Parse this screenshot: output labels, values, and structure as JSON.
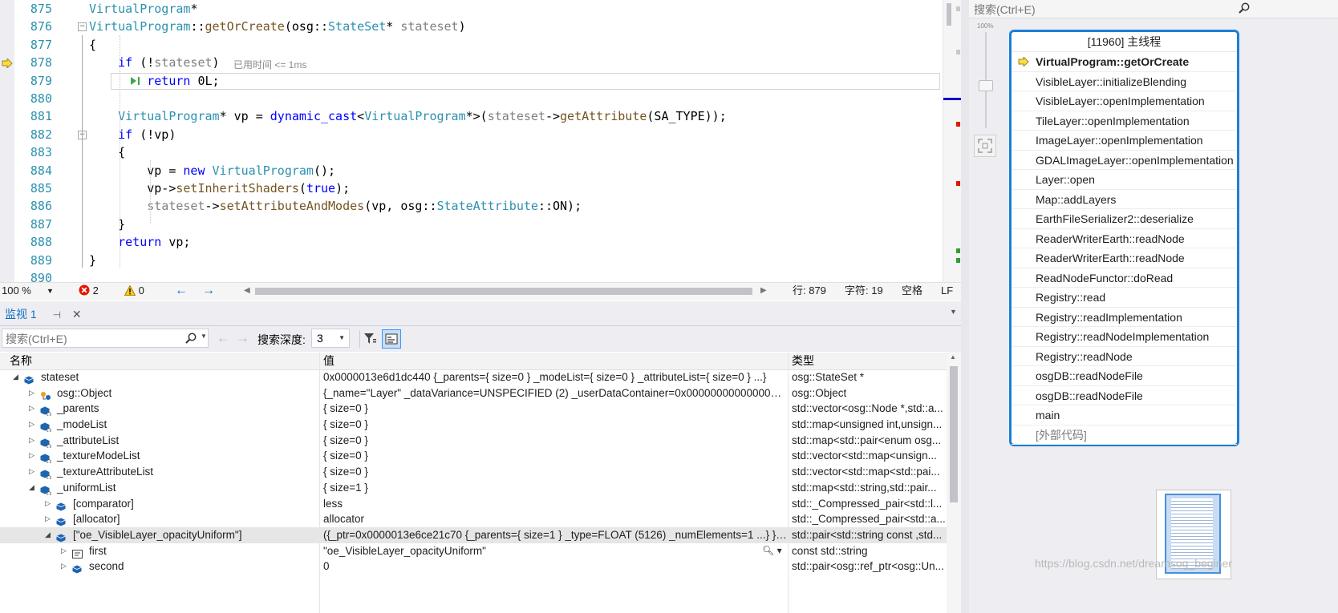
{
  "editor": {
    "lines": [
      {
        "num": "875",
        "code": [
          {
            "c": "t",
            "v": "VirtualProgram"
          },
          {
            "c": "n",
            "v": "*"
          }
        ]
      },
      {
        "num": "876",
        "code": [
          {
            "c": "t",
            "v": "VirtualProgram"
          },
          {
            "c": "n",
            "v": "::"
          },
          {
            "c": "f",
            "v": "getOrCreate"
          },
          {
            "c": "n",
            "v": "("
          },
          {
            "c": "n",
            "v": "osg"
          },
          {
            "c": "n",
            "v": "::"
          },
          {
            "c": "t",
            "v": "StateSet"
          },
          {
            "c": "n",
            "v": "* "
          },
          {
            "c": "p",
            "v": "stateset"
          },
          {
            "c": "n",
            "v": ")"
          }
        ]
      },
      {
        "num": "877",
        "code": [
          {
            "c": "n",
            "v": "{"
          }
        ]
      },
      {
        "num": "878",
        "code": [
          {
            "c": "n",
            "v": "    "
          },
          {
            "c": "k",
            "v": "if"
          },
          {
            "c": "n",
            "v": " (!"
          },
          {
            "c": "p",
            "v": "stateset"
          },
          {
            "c": "n",
            "v": ")"
          }
        ]
      },
      {
        "num": "879",
        "code": [
          {
            "c": "n",
            "v": "        "
          },
          {
            "c": "k",
            "v": "return"
          },
          {
            "c": "n",
            "v": " 0L;"
          }
        ]
      },
      {
        "num": "880",
        "code": []
      },
      {
        "num": "881",
        "code": [
          {
            "c": "n",
            "v": "    "
          },
          {
            "c": "t",
            "v": "VirtualProgram"
          },
          {
            "c": "n",
            "v": "* vp = "
          },
          {
            "c": "k",
            "v": "dynamic_cast"
          },
          {
            "c": "n",
            "v": "<"
          },
          {
            "c": "t",
            "v": "VirtualProgram"
          },
          {
            "c": "n",
            "v": "*>("
          },
          {
            "c": "p",
            "v": "stateset"
          },
          {
            "c": "n",
            "v": "->"
          },
          {
            "c": "f",
            "v": "getAttribute"
          },
          {
            "c": "n",
            "v": "(SA_TYPE));"
          }
        ]
      },
      {
        "num": "882",
        "code": [
          {
            "c": "n",
            "v": "    "
          },
          {
            "c": "k",
            "v": "if"
          },
          {
            "c": "n",
            "v": " (!vp)"
          }
        ]
      },
      {
        "num": "883",
        "code": [
          {
            "c": "n",
            "v": "    {"
          }
        ]
      },
      {
        "num": "884",
        "code": [
          {
            "c": "n",
            "v": "        vp = "
          },
          {
            "c": "k",
            "v": "new"
          },
          {
            "c": "n",
            "v": " "
          },
          {
            "c": "t",
            "v": "VirtualProgram"
          },
          {
            "c": "n",
            "v": "();"
          }
        ]
      },
      {
        "num": "885",
        "code": [
          {
            "c": "n",
            "v": "        vp->"
          },
          {
            "c": "f",
            "v": "setInheritShaders"
          },
          {
            "c": "n",
            "v": "("
          },
          {
            "c": "k",
            "v": "true"
          },
          {
            "c": "n",
            "v": ");"
          }
        ]
      },
      {
        "num": "886",
        "code": [
          {
            "c": "n",
            "v": "        "
          },
          {
            "c": "p",
            "v": "stateset"
          },
          {
            "c": "n",
            "v": "->"
          },
          {
            "c": "f",
            "v": "setAttributeAndModes"
          },
          {
            "c": "n",
            "v": "(vp, osg::"
          },
          {
            "c": "t",
            "v": "StateAttribute"
          },
          {
            "c": "n",
            "v": "::ON);"
          }
        ]
      },
      {
        "num": "887",
        "code": [
          {
            "c": "n",
            "v": "    }"
          }
        ]
      },
      {
        "num": "888",
        "code": [
          {
            "c": "n",
            "v": "    "
          },
          {
            "c": "k",
            "v": "return"
          },
          {
            "c": "n",
            "v": " vp;"
          }
        ]
      },
      {
        "num": "889",
        "code": [
          {
            "c": "n",
            "v": "}"
          }
        ]
      },
      {
        "num": "890",
        "code": []
      }
    ],
    "elapsed_hint": "已用时间 <= 1ms",
    "status": {
      "zoom": "100 %",
      "errors": "2",
      "warnings": "0",
      "line": "行: 879",
      "char": "字符: 19",
      "whitespace": "空格",
      "eol": "LF"
    }
  },
  "watch": {
    "tab_label": "监视 1",
    "search_placeholder": "搜索(Ctrl+E)",
    "depth_label": "搜索深度:",
    "depth_value": "3",
    "columns": {
      "name": "名称",
      "value": "值",
      "type": "类型"
    },
    "rows": [
      {
        "indent": 0,
        "exp": "◢",
        "icon": "object",
        "name": "stateset",
        "value": "0x0000013e6d1dc440 {_parents={ size=0 } _modeList={ size=0 } _attributeList={ size=0 } ...}",
        "type": "osg::StateSet *"
      },
      {
        "indent": 1,
        "exp": "▷",
        "icon": "base",
        "name": "osg::Object",
        "value": "{_name=\"Layer\" _dataVariance=UNSPECIFIED (2) _userDataContainer=0x0000000000000000...",
        "type": "osg::Object"
      },
      {
        "indent": 1,
        "exp": "▷",
        "icon": "field",
        "name": "_parents",
        "value": "{ size=0 }",
        "type": "std::vector<osg::Node *,std::a..."
      },
      {
        "indent": 1,
        "exp": "▷",
        "icon": "field",
        "name": "_modeList",
        "value": "{ size=0 }",
        "type": "std::map<unsigned int,unsign..."
      },
      {
        "indent": 1,
        "exp": "▷",
        "icon": "field",
        "name": "_attributeList",
        "value": "{ size=0 }",
        "type": "std::map<std::pair<enum osg..."
      },
      {
        "indent": 1,
        "exp": "▷",
        "icon": "field",
        "name": "_textureModeList",
        "value": "{ size=0 }",
        "type": "std::vector<std::map<unsign..."
      },
      {
        "indent": 1,
        "exp": "▷",
        "icon": "field",
        "name": "_textureAttributeList",
        "value": "{ size=0 }",
        "type": "std::vector<std::map<std::pai..."
      },
      {
        "indent": 1,
        "exp": "◢",
        "icon": "field",
        "name": "_uniformList",
        "value": "{ size=1 }",
        "type": "std::map<std::string,std::pair..."
      },
      {
        "indent": 2,
        "exp": "▷",
        "icon": "object",
        "name": "[comparator]",
        "value": "less",
        "type": "std::_Compressed_pair<std::l..."
      },
      {
        "indent": 2,
        "exp": "▷",
        "icon": "object",
        "name": "[allocator]",
        "value": "allocator",
        "type": "std::_Compressed_pair<std::a..."
      },
      {
        "indent": 2,
        "exp": "◢",
        "icon": "object",
        "name": "[\"oe_VisibleLayer_opacityUniform\"]",
        "value": "({_ptr=0x0000013e6ce21c70 {_parents={ size=1 } _type=FLOAT (5126) _numElements=1 ...} }, ...",
        "type": "std::pair<std::string const ,std...",
        "selected": true
      },
      {
        "indent": 3,
        "exp": "▷",
        "icon": "string",
        "name": "first",
        "value": "\"oe_VisibleLayer_opacityUniform\"",
        "type": "const std::string"
      },
      {
        "indent": 3,
        "exp": "▷",
        "icon": "object",
        "name": "second",
        "value": "0",
        "type": "std::pair<osg::ref_ptr<osg::Un..."
      }
    ]
  },
  "right_panel": {
    "search_placeholder": "搜索(Ctrl+E)",
    "zoom_label": "100%",
    "callstack_title": "[11960] 主线程",
    "frames": [
      {
        "name": "VirtualProgram::getOrCreate",
        "current": true
      },
      {
        "name": "VisibleLayer::initializeBlending"
      },
      {
        "name": "VisibleLayer::openImplementation"
      },
      {
        "name": "TileLayer::openImplementation"
      },
      {
        "name": "ImageLayer::openImplementation"
      },
      {
        "name": "GDALImageLayer::openImplementation"
      },
      {
        "name": "Layer::open"
      },
      {
        "name": "Map::addLayers"
      },
      {
        "name": "EarthFileSerializer2::deserialize"
      },
      {
        "name": "ReaderWriterEarth::readNode"
      },
      {
        "name": "ReaderWriterEarth::readNode"
      },
      {
        "name": "ReadNodeFunctor::doRead"
      },
      {
        "name": "Registry::read"
      },
      {
        "name": "Registry::readImplementation"
      },
      {
        "name": "Registry::readNodeImplementation"
      },
      {
        "name": "Registry::readNode"
      },
      {
        "name": "osgDB::readNodeFile"
      },
      {
        "name": "osgDB::readNodeFile"
      },
      {
        "name": "main"
      },
      {
        "name": "[外部代码]",
        "external": true
      }
    ]
  },
  "watermark": "https://blog.csdn.net/dreamsog_beginer",
  "colors": {
    "type": "#2b91af",
    "keyword": "#0000ff",
    "function": "#74531f",
    "parameter": "#808080",
    "accent": "#1c7fd6",
    "error": "#e51400"
  }
}
